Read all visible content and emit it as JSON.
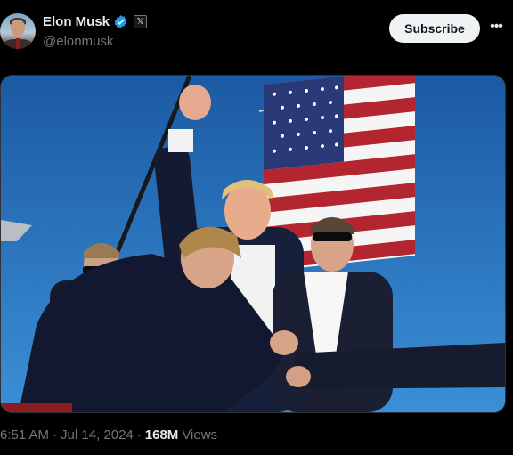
{
  "post": {
    "author": {
      "display_name": "Elon Musk",
      "handle": "@elonmusk",
      "verified_color": "#1d9bf0",
      "badge_glyph": "𝕏"
    },
    "subscribe_label": "Subscribe",
    "more_icon": "more-horizontal-icon",
    "media": {
      "icon": "photo"
    },
    "meta": {
      "time": "6:51 AM",
      "separator": "·",
      "date": "Jul 14, 2024",
      "views_count": "168M",
      "views_label": "Views"
    }
  }
}
